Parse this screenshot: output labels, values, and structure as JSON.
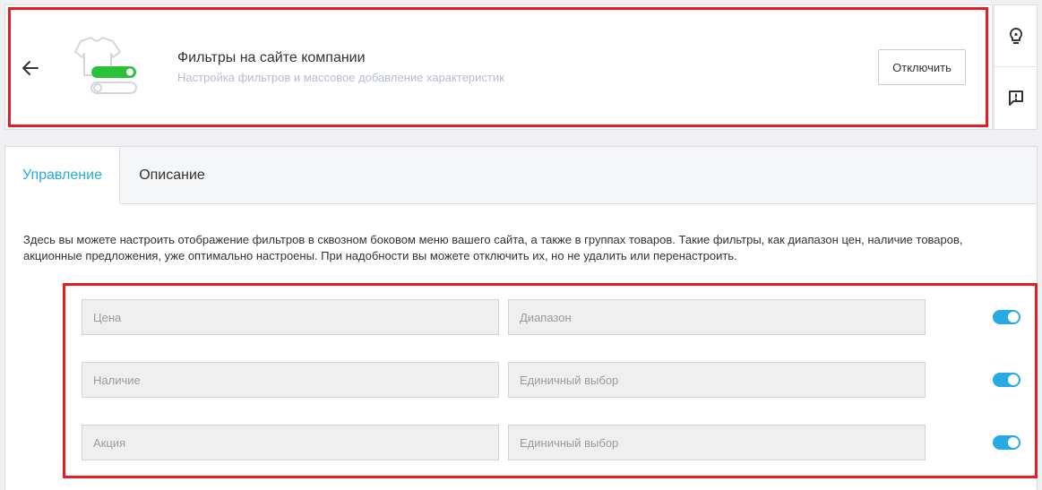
{
  "header": {
    "title": "Фильтры на сайте компании",
    "subtitle": "Настройка фильтров и массовое добавление характеристик",
    "disable_label": "Отключить",
    "back_icon": "arrow-left-icon",
    "illustration_icon": "tshirt-filter-icon"
  },
  "side_panel": {
    "items": [
      {
        "icon": "lightbulb-icon"
      },
      {
        "icon": "report-icon"
      }
    ]
  },
  "tabs": [
    {
      "label": "Управление",
      "active": true
    },
    {
      "label": "Описание",
      "active": false
    }
  ],
  "description": "Здесь вы можете настроить отображение фильтров в сквозном боковом меню вашего сайта, а также в группах товаров. Такие фильтры, как диапазон цен, наличие товаров, акционные предложения, уже оптимально настроены. При надобности вы можете отключить их, но не удалить или перенастроить.",
  "filters": [
    {
      "name": "Цена",
      "type": "Диапазон",
      "enabled": true
    },
    {
      "name": "Наличие",
      "type": "Единичный выбор",
      "enabled": true
    },
    {
      "name": "Акция",
      "type": "Единичный выбор",
      "enabled": true
    }
  ],
  "colors": {
    "accent": "#27aae1",
    "highlight": "#e31e24",
    "toggle_on": "#27aae1",
    "illustration_green": "#2bc23b"
  }
}
